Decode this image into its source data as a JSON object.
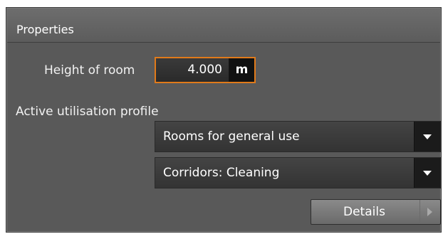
{
  "panel": {
    "title": "Properties"
  },
  "height_field": {
    "label": "Height of room",
    "value": "4.000",
    "unit": "m"
  },
  "profile": {
    "label": "Active utilisation profile",
    "category_selected": "Rooms for general use",
    "profile_selected": "Corridors: Cleaning"
  },
  "details_button": {
    "label": "Details"
  },
  "colors": {
    "panel_background": "#595959",
    "focus_border": "#e07a1a",
    "field_background": "#2f2f2f"
  },
  "icons": {
    "dropdown_arrow": "chevron-down-icon",
    "details_arrow": "chevron-right-icon"
  }
}
